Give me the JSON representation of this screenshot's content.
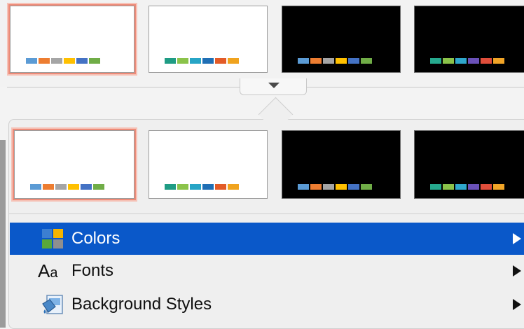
{
  "colors": {
    "accent": "#0a58c9",
    "selected_border": "#ee8a77"
  },
  "themes": [
    {
      "bg": "white",
      "selected": true,
      "swatches": [
        "#5b9bd5",
        "#ed7d31",
        "#a5a5a5",
        "#ffc000",
        "#4472c4",
        "#70ad47"
      ]
    },
    {
      "bg": "white",
      "selected": false,
      "swatches": [
        "#1f9c84",
        "#8bc34a",
        "#27a5c6",
        "#1f6fb5",
        "#e35b27",
        "#f0a31e"
      ]
    },
    {
      "bg": "black",
      "selected": false,
      "swatches": [
        "#5b9bd5",
        "#ed7d31",
        "#a5a5a5",
        "#ffc000",
        "#4472c4",
        "#70ad47"
      ]
    },
    {
      "bg": "black",
      "selected": false,
      "swatches": [
        "#26a98e",
        "#8bc34a",
        "#2fa7cc",
        "#6a51b8",
        "#e04e3b",
        "#f2a527"
      ]
    }
  ],
  "menu": {
    "items": [
      {
        "label": "Colors",
        "icon": "colors-grid-icon",
        "active": true
      },
      {
        "label": "Fonts",
        "icon": "font-aa-icon",
        "active": false
      },
      {
        "label": "Background Styles",
        "icon": "background-styles-icon",
        "active": false
      }
    ],
    "font_icon_glyph_big": "A",
    "font_icon_glyph_small": "a"
  }
}
